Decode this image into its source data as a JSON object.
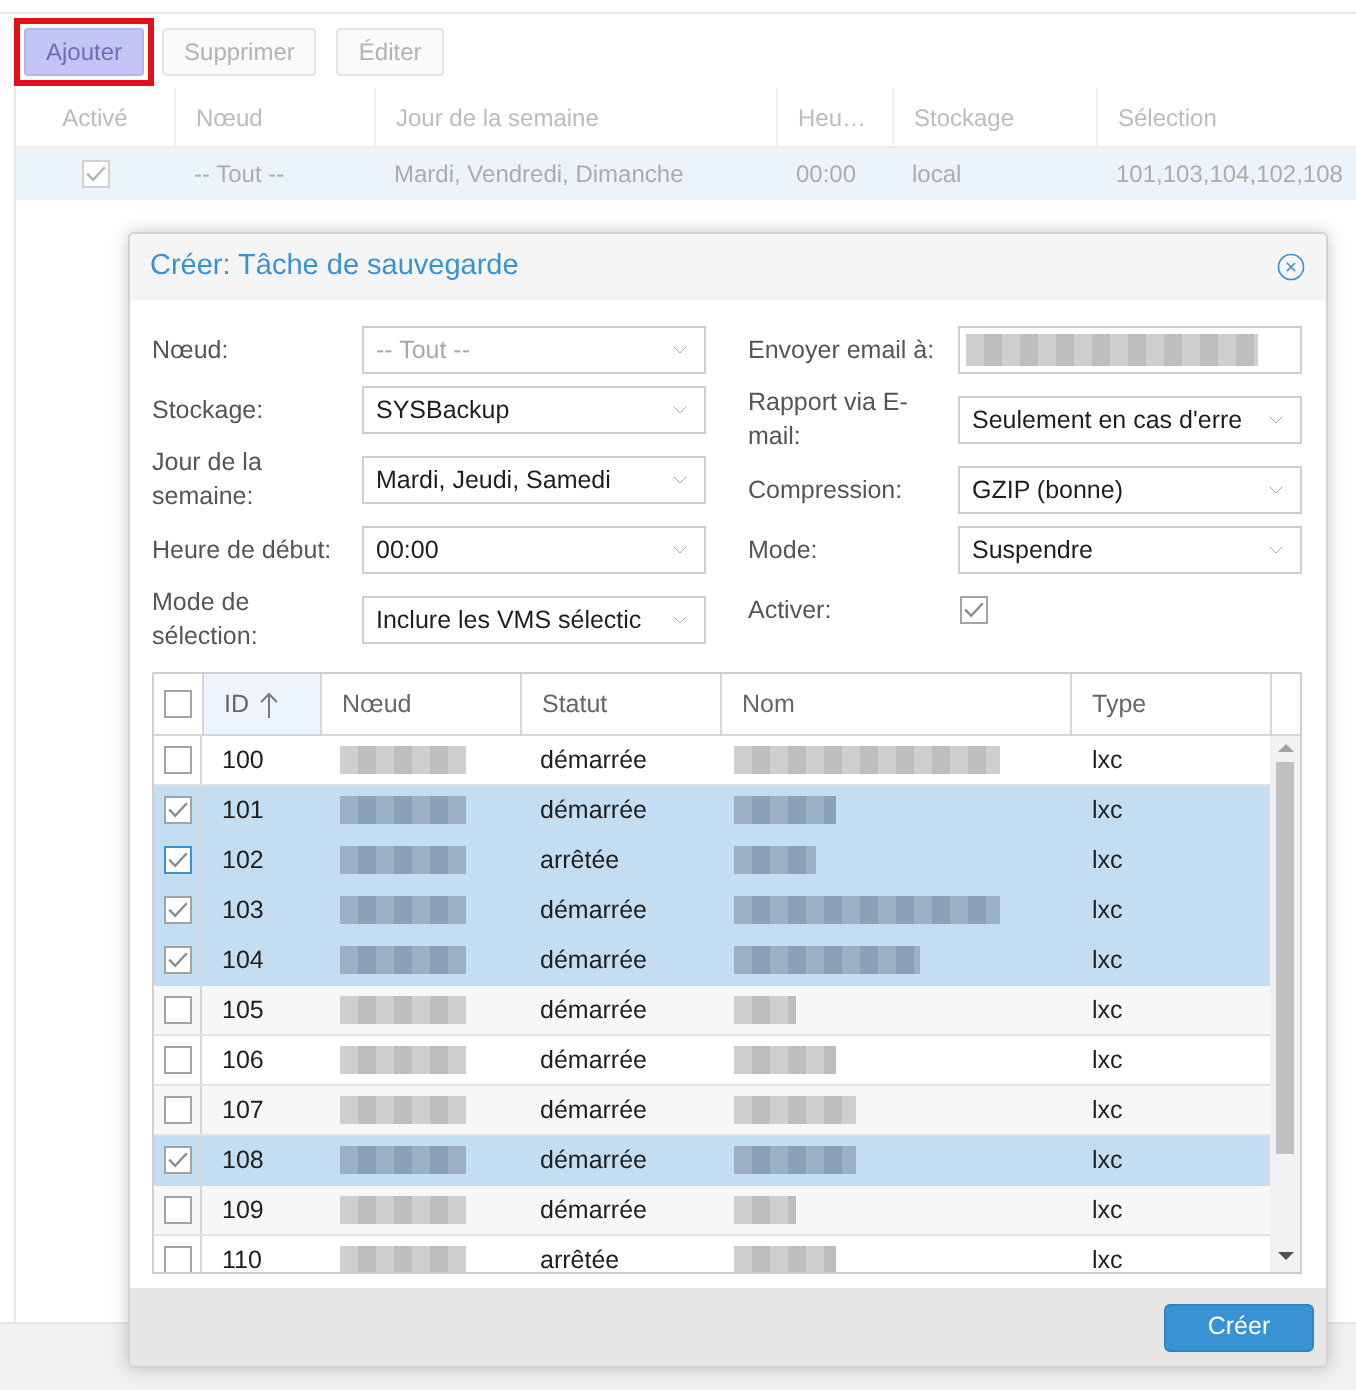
{
  "toolbar": {
    "buttons": [
      {
        "label": "Ajouter",
        "kind": "primary",
        "highlighted": true
      },
      {
        "label": "Supprimer",
        "kind": "default",
        "highlighted": false
      },
      {
        "label": "Éditer",
        "kind": "default",
        "highlighted": false
      }
    ]
  },
  "jobs_table": {
    "check_column": "Activé",
    "columns": [
      "Nœud",
      "Jour de la semaine",
      "Heu…",
      "Stockage",
      "Sélection"
    ],
    "rows": [
      {
        "enabled": true,
        "selected": true,
        "cells": [
          "-- Tout --",
          "Mardi, Vendredi, Dimanche",
          "00:00",
          "local",
          "101,103,104,102,108"
        ]
      }
    ]
  },
  "dialog": {
    "title": "Créer: Tâche de sauvegarde",
    "left_fields": [
      {
        "label": "Nœud:",
        "kind": "select",
        "placeholder": "-- Tout --"
      },
      {
        "label": "Stockage:",
        "kind": "select",
        "value": "SYSBackup"
      },
      {
        "label": "Jour de la semaine:",
        "kind": "select",
        "value": "Mardi, Jeudi, Samedi"
      },
      {
        "label": "Heure de début:",
        "kind": "select",
        "value": "00:00"
      },
      {
        "label": "Mode de sélection:",
        "kind": "select",
        "value": "Inclure les VMS sélectic"
      }
    ],
    "right_fields": [
      {
        "label": "Envoyer email à:",
        "kind": "text",
        "redacted": true
      },
      {
        "label": "Rapport via E-mail:",
        "kind": "select",
        "value": "Seulement en cas d'erre"
      },
      {
        "label": "Compression:",
        "kind": "select",
        "value": "GZIP (bonne)"
      },
      {
        "label": "Mode:",
        "kind": "select",
        "value": "Suspendre"
      },
      {
        "label": "Activer:",
        "kind": "checkbox",
        "checked": true
      }
    ],
    "grid": {
      "columns": [
        {
          "kind": "check",
          "checked": false
        },
        {
          "kind": "id",
          "label": "ID",
          "sorted": true
        },
        {
          "kind": "redacted",
          "label": "Nœud",
          "sorted": false
        },
        {
          "kind": "status",
          "label": "Statut",
          "sorted": false
        },
        {
          "kind": "redacted",
          "label": "Nom",
          "sorted": false
        },
        {
          "kind": "type",
          "label": "Type",
          "sorted": false
        }
      ],
      "rows": [
        {
          "id": "100",
          "status": "démarrée",
          "type": "lxc",
          "selected": false,
          "focused": false
        },
        {
          "id": "101",
          "status": "démarrée",
          "type": "lxc",
          "selected": true,
          "focused": false
        },
        {
          "id": "102",
          "status": "arrêtée",
          "type": "lxc",
          "selected": true,
          "focused": true
        },
        {
          "id": "103",
          "status": "démarrée",
          "type": "lxc",
          "selected": true,
          "focused": false
        },
        {
          "id": "104",
          "status": "démarrée",
          "type": "lxc",
          "selected": true,
          "focused": false
        },
        {
          "id": "105",
          "status": "démarrée",
          "type": "lxc",
          "selected": false,
          "focused": false
        },
        {
          "id": "106",
          "status": "démarrée",
          "type": "lxc",
          "selected": false,
          "focused": false
        },
        {
          "id": "107",
          "status": "démarrée",
          "type": "lxc",
          "selected": false,
          "focused": false
        },
        {
          "id": "108",
          "status": "démarrée",
          "type": "lxc",
          "selected": true,
          "focused": false
        },
        {
          "id": "109",
          "status": "démarrée",
          "type": "lxc",
          "selected": false,
          "focused": false
        },
        {
          "id": "110",
          "status": "arrêtée",
          "type": "lxc",
          "selected": false,
          "focused": false
        }
      ]
    },
    "buttons": [
      {
        "label": "Créer",
        "kind": "primary"
      }
    ]
  }
}
